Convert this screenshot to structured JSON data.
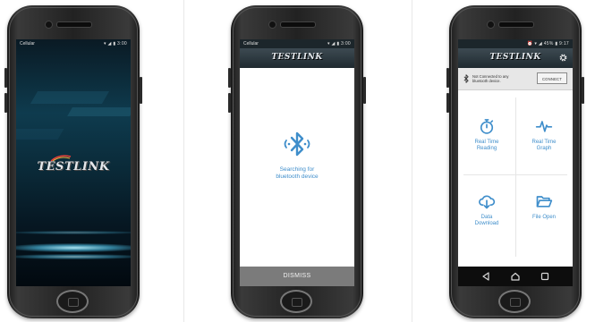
{
  "app": {
    "logo_text": "TESTLINK"
  },
  "phone1": {
    "status": {
      "carrier": "Cellular",
      "right": "▾ ◢ ▮ 3:00"
    }
  },
  "phone2": {
    "status": {
      "carrier": "Cellular",
      "right": "▾ ◢ ▮ 3:00"
    },
    "searching_line1": "Searching for",
    "searching_line2": "bluetooth device",
    "dismiss_label": "DISMISS"
  },
  "phone3": {
    "status": {
      "right": "⏰ ▾ ◢ 45% ▮ 9:17"
    },
    "connection_line1": "Not Connected to any",
    "connection_line2": "bluetooth device.",
    "connect_label": "CONNECT",
    "tiles": [
      {
        "line1": "Real Time",
        "line2": "Reading",
        "icon": "stopwatch-icon"
      },
      {
        "line1": "Real Time",
        "line2": "Graph",
        "icon": "pulse-icon"
      },
      {
        "line1": "Data",
        "line2": "Download",
        "icon": "cloud-download-icon"
      },
      {
        "line1": "File Open",
        "line2": "",
        "icon": "folder-open-icon"
      }
    ]
  },
  "colors": {
    "accent": "#3f8ecb",
    "dismiss_bar": "#7b7b7b",
    "app_header": "#2a353b",
    "nav_bar": "#0d0d0d",
    "logo_silver": "#e4e8ec"
  }
}
